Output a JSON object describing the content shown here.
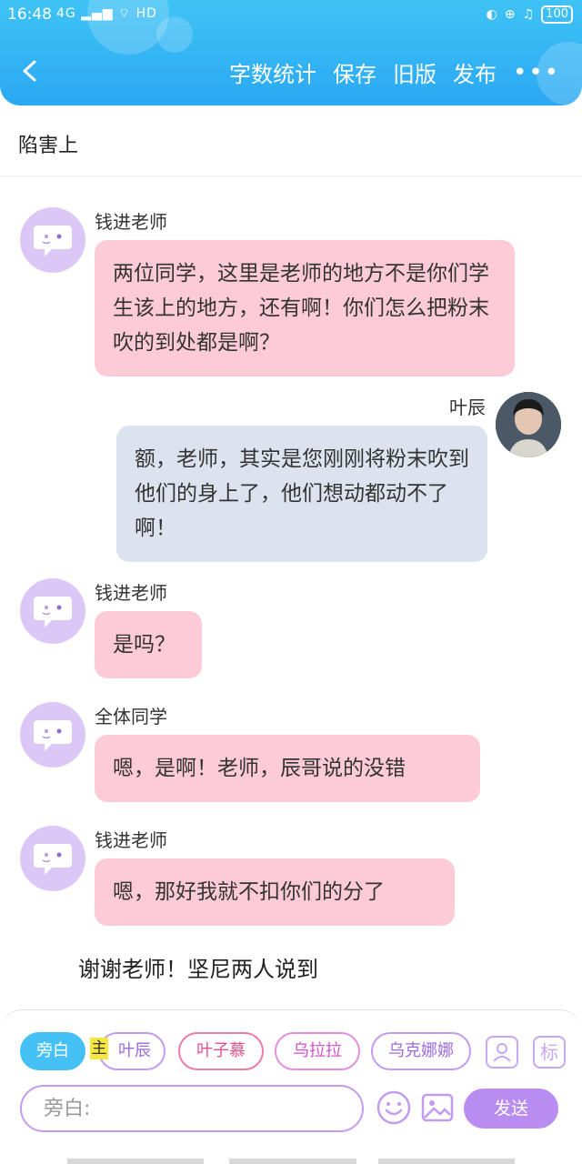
{
  "status_bar": {
    "time": "16:48",
    "signal": "4G",
    "battery": "100"
  },
  "header": {
    "actions": [
      "字数统计",
      "保存",
      "旧版",
      "发布"
    ],
    "more_label": "•••"
  },
  "story_title": "陷害上",
  "messages": [
    {
      "sender": "钱进老师",
      "text": "两位同学，这里是老师的地方不是你们学生该上的地方，还有啊！你们怎么把粉末吹的到处都是啊？",
      "side": "left"
    },
    {
      "sender": "叶辰",
      "text": "额，老师，其实是您刚刚将粉末吹到他们的身上了，他们想动都动不了啊！",
      "side": "right"
    },
    {
      "sender": "钱进老师",
      "text": "是吗？",
      "side": "left"
    },
    {
      "sender": "全体同学",
      "text": "嗯，是啊！老师，辰哥说的没错",
      "side": "left"
    },
    {
      "sender": "钱进老师",
      "text": "嗯，那好我就不扣你们的分了",
      "side": "left"
    }
  ],
  "narration": "谢谢老师！坚尼两人说到",
  "composer": {
    "roles": [
      "旁白",
      "叶辰",
      "叶子慕",
      "乌拉拉",
      "乌克娜娜"
    ],
    "host_badge": "主",
    "mark_button": "标",
    "input_placeholder": "旁白:",
    "send_label": "发送"
  },
  "colors": {
    "header": "#2aa8f3",
    "left_bubble": "#fdcad8",
    "right_bubble": "#dde3ee",
    "accent_purple": "#b98cf2"
  }
}
